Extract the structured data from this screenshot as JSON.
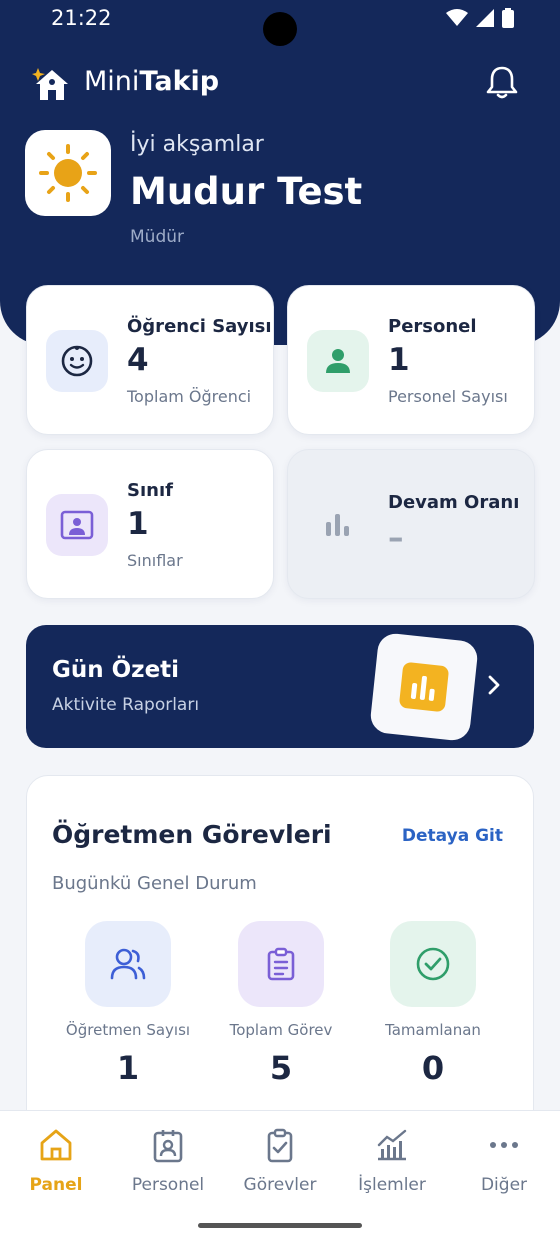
{
  "status_bar": {
    "time": "21:22"
  },
  "app": {
    "name_light": "Mini",
    "name_bold": "Takip"
  },
  "user": {
    "greeting": "İyi akşamlar",
    "name": "Mudur Test",
    "role": "Müdür"
  },
  "stats": [
    {
      "title": "Öğrenci Sayısı",
      "value": "4",
      "subtitle": "Toplam Öğrenci",
      "icon": "baby-face-icon",
      "color": "#3d5fd6"
    },
    {
      "title": "Personel",
      "value": "1",
      "subtitle": "Personel Sayısı",
      "icon": "person-icon",
      "color": "#2f9e6a"
    },
    {
      "title": "Sınıf",
      "value": "1",
      "subtitle": "Sınıflar",
      "icon": "class-board-icon",
      "color": "#7a5fd6"
    },
    {
      "title": "Devam Oranı",
      "value": "–",
      "subtitle": "",
      "icon": "bar-chart-icon",
      "color": "#9aa3b2"
    }
  ],
  "banner": {
    "title": "Gün Özeti",
    "subtitle": "Aktivite Raporları",
    "icon": "report-chart-icon",
    "accent": "#f3b321"
  },
  "tasks": {
    "title": "Öğretmen Görevleri",
    "link": "Detaya Git",
    "subtitle": "Bugünkü Genel Durum",
    "metrics": [
      {
        "label": "Öğretmen Sayısı",
        "value": "1",
        "icon": "users-icon"
      },
      {
        "label": "Toplam Görev",
        "value": "5",
        "icon": "clipboard-icon"
      },
      {
        "label": "Tamamlanan",
        "value": "0",
        "icon": "check-circle-icon"
      }
    ]
  },
  "nav": {
    "items": [
      {
        "label": "Panel",
        "icon": "home-icon",
        "active": true
      },
      {
        "label": "Personel",
        "icon": "badge-icon"
      },
      {
        "label": "Görevler",
        "icon": "clipboard-check-icon"
      },
      {
        "label": "İşlemler",
        "icon": "trend-chart-icon"
      },
      {
        "label": "Diğer",
        "icon": "more-dots-icon"
      }
    ]
  },
  "colors": {
    "primary": "#14285a",
    "accent": "#e6a417",
    "link": "#2b63c4"
  }
}
